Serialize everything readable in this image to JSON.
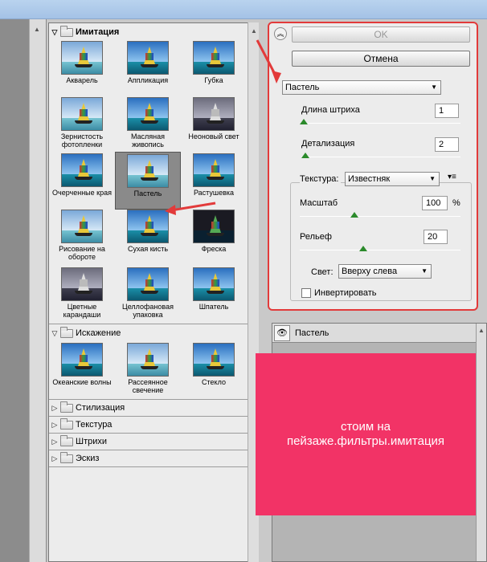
{
  "gallery": {
    "categories": [
      {
        "name": "Имитация",
        "open": true,
        "items": [
          {
            "label": "Акварель"
          },
          {
            "label": "Аппликация"
          },
          {
            "label": "Губка"
          },
          {
            "label": "Зернистость фотопленки"
          },
          {
            "label": "Масляная живопись"
          },
          {
            "label": "Неоновый свет"
          },
          {
            "label": "Очерченные края"
          },
          {
            "label": "Пастель",
            "selected": true
          },
          {
            "label": "Растушевка"
          },
          {
            "label": "Рисование на обороте"
          },
          {
            "label": "Сухая кисть"
          },
          {
            "label": "Фреска"
          },
          {
            "label": "Цветные карандаши"
          },
          {
            "label": "Целлофановая упаковка"
          },
          {
            "label": "Шпатель"
          }
        ]
      },
      {
        "name": "Искажение",
        "open": true,
        "items": [
          {
            "label": "Океанские волны"
          },
          {
            "label": "Рассеянное свечение"
          },
          {
            "label": "Стекло"
          }
        ]
      },
      {
        "name": "Стилизация",
        "open": false
      },
      {
        "name": "Текстура",
        "open": false
      },
      {
        "name": "Штрихи",
        "open": false
      },
      {
        "name": "Эскиз",
        "open": false
      }
    ]
  },
  "settings": {
    "ok_label": "OK",
    "cancel_label": "Отмена",
    "filter_select": "Пастель",
    "stroke_length": {
      "label": "Длина штриха",
      "value": "1"
    },
    "detail": {
      "label": "Детализация",
      "value": "2"
    },
    "texture": {
      "label": "Текстура:",
      "value": "Известняк"
    },
    "scale": {
      "label": "Масштаб",
      "value": "100",
      "unit": "%"
    },
    "relief": {
      "label": "Рельеф",
      "value": "20"
    },
    "light": {
      "label": "Свет:",
      "value": "Вверху слева"
    },
    "invert": {
      "label": "Инвертировать",
      "checked": false
    }
  },
  "layers": {
    "row_label": "Пастель"
  },
  "note": {
    "text": "стоим на пейзаже.фильтры.имитация"
  },
  "colors": {
    "highlight_red": "#e23a3a",
    "note_bg": "#f23366"
  }
}
